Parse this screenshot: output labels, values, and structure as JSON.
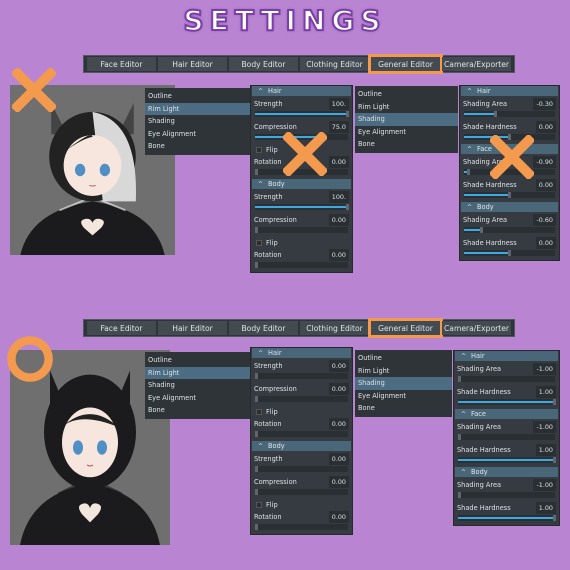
{
  "title": "SETTINGS",
  "colors": {
    "background": "#b985d2",
    "accent": "#f39a4e",
    "slider": "#3ca9e2",
    "selected": "#4b6c82"
  },
  "tabs": [
    "Face Editor",
    "Hair Editor",
    "Body Editor",
    "Clothing Editor",
    "General Editor",
    "Camera/Exporter"
  ],
  "active_tab": "General Editor",
  "menu_items": [
    "Outline",
    "Rim Light",
    "Shading",
    "Eye Alignment",
    "Bone"
  ],
  "sections": [
    {
      "mark": "x-mark-icon",
      "rim_light": {
        "selected": "Rim Light",
        "groups": [
          {
            "name": "Hair",
            "rows": [
              {
                "label": "Strength",
                "value": "100.",
                "fill": 1.0
              },
              {
                "label": "Compression",
                "value": "75.0",
                "fill": 0.75
              },
              {
                "flip": "Flip"
              },
              {
                "label": "Rotation",
                "value": "0.00",
                "fill": 0
              }
            ]
          },
          {
            "name": "Body",
            "rows": [
              {
                "label": "Strength",
                "value": "100.",
                "fill": 1.0
              },
              {
                "label": "Compression",
                "value": "0.00",
                "fill": 0
              },
              {
                "flip": "Flip"
              },
              {
                "label": "Rotation",
                "value": "0.00",
                "fill": 0
              }
            ]
          }
        ]
      },
      "shading": {
        "selected": "Shading",
        "groups": [
          {
            "name": "Hair",
            "rows": [
              {
                "label": "Shading Area",
                "value": "-0.30",
                "fill": 0.35
              },
              {
                "label": "Shade Hardness",
                "value": "0.00",
                "fill": 0.5
              }
            ]
          },
          {
            "name": "Face",
            "rows": [
              {
                "label": "Shading Area",
                "value": "-0.90",
                "fill": 0.05
              },
              {
                "label": "Shade Hardness",
                "value": "0.00",
                "fill": 0.5
              }
            ]
          },
          {
            "name": "Body",
            "rows": [
              {
                "label": "Shading Area",
                "value": "-0.60",
                "fill": 0.2
              },
              {
                "label": "Shade Hardness",
                "value": "0.00",
                "fill": 0.5
              }
            ]
          }
        ]
      }
    },
    {
      "mark": "circle-mark-icon",
      "rim_light": {
        "selected": "Rim Light",
        "groups": [
          {
            "name": "Hair",
            "rows": [
              {
                "label": "Strength",
                "value": "0.00",
                "fill": 0
              },
              {
                "label": "Compression",
                "value": "0.00",
                "fill": 0
              },
              {
                "flip": "Flip"
              },
              {
                "label": "Rotation",
                "value": "0.00",
                "fill": 0
              }
            ]
          },
          {
            "name": "Body",
            "rows": [
              {
                "label": "Strength",
                "value": "0.00",
                "fill": 0
              },
              {
                "label": "Compression",
                "value": "0.00",
                "fill": 0
              },
              {
                "flip": "Flip"
              },
              {
                "label": "Rotation",
                "value": "0.00",
                "fill": 0
              }
            ]
          }
        ]
      },
      "shading": {
        "selected": "Shading",
        "groups": [
          {
            "name": "Hair",
            "rows": [
              {
                "label": "Shading Area",
                "value": "-1.00",
                "fill": 0
              },
              {
                "label": "Shade Hardness",
                "value": "1.00",
                "fill": 1
              }
            ]
          },
          {
            "name": "Face",
            "rows": [
              {
                "label": "Shading Area",
                "value": "-1.00",
                "fill": 0
              },
              {
                "label": "Shade Hardness",
                "value": "1.00",
                "fill": 1
              }
            ]
          },
          {
            "name": "Body",
            "rows": [
              {
                "label": "Shading Area",
                "value": "-1.00",
                "fill": 0
              },
              {
                "label": "Shade Hardness",
                "value": "1.00",
                "fill": 1
              }
            ]
          }
        ]
      }
    }
  ]
}
